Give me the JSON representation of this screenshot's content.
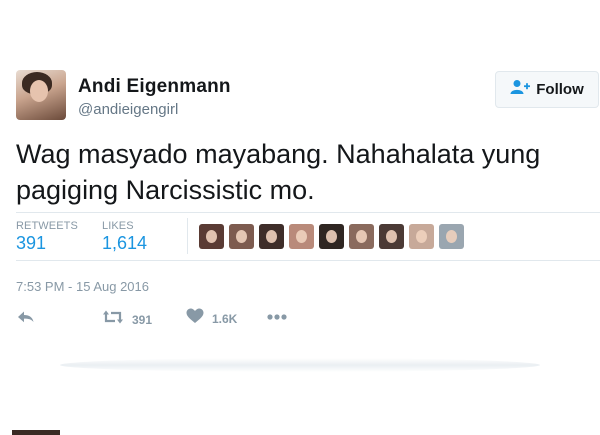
{
  "tweet": {
    "display_name": "Andi Eigenmann",
    "screen_name": "@andieigengirl",
    "follow_label": "Follow",
    "text": "Wag masyado mayabang. Nahahalata yung pagiging Narcissistic mo.",
    "timestamp": "7:53 PM - 15 Aug 2016"
  },
  "stats": {
    "retweets_label": "RETWEETS",
    "retweets_value": "391",
    "likes_label": "LIKES",
    "likes_value": "1,614"
  },
  "likers": [
    {
      "color": "#5a3b34"
    },
    {
      "color": "#7d5b4f"
    },
    {
      "color": "#3e2d29"
    },
    {
      "color": "#b98a7a"
    },
    {
      "color": "#2f2622"
    },
    {
      "color": "#8a6a5d"
    },
    {
      "color": "#4b3a35"
    },
    {
      "color": "#c7a999"
    },
    {
      "color": "#9aa6b0"
    }
  ],
  "actions": {
    "reply_icon": "reply-icon",
    "retweet_icon": "retweet-icon",
    "retweet_count": "391",
    "like_icon": "heart-icon",
    "like_count": "1.6K",
    "more_icon": "more-icon"
  },
  "colors": {
    "accent": "#1b95e0",
    "muted": "#8899a6",
    "text": "#14171a"
  }
}
